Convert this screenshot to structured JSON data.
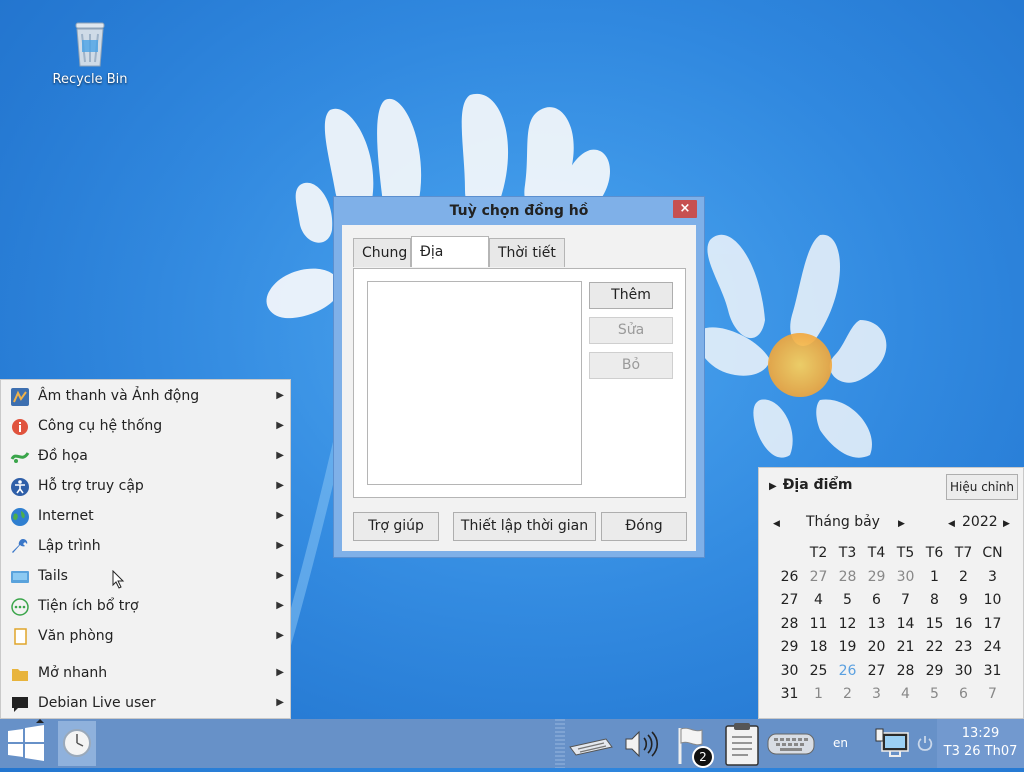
{
  "desktop": {
    "icons": [
      {
        "label": "Recycle Bin",
        "icon": "recycle-bin-icon"
      }
    ]
  },
  "dialog": {
    "title": "Tuỳ chọn đồng hồ",
    "close_symbol": "×",
    "tabs": [
      {
        "label": "Chung",
        "active": false
      },
      {
        "label": "Địa điểm",
        "active": true
      },
      {
        "label": "Thời tiết",
        "active": false
      }
    ],
    "side_buttons": [
      {
        "label": "Thêm",
        "enabled": true
      },
      {
        "label": "Sửa",
        "enabled": false
      },
      {
        "label": "Bỏ",
        "enabled": false
      }
    ],
    "bottom_buttons": {
      "help": "Trợ giúp",
      "set_time": "Thiết lập thời gian",
      "close": "Đóng"
    }
  },
  "start_menu": {
    "items": [
      {
        "label": "Âm thanh và Ảnh động",
        "icon": "multimedia-icon"
      },
      {
        "label": "Công cụ hệ thống",
        "icon": "system-info-icon"
      },
      {
        "label": "Đồ họa",
        "icon": "graphics-icon"
      },
      {
        "label": "Hỗ trợ truy cập",
        "icon": "accessibility-icon"
      },
      {
        "label": "Internet",
        "icon": "globe-icon"
      },
      {
        "label": "Lập trình",
        "icon": "wrench-icon"
      },
      {
        "label": "Tails",
        "icon": "tails-icon"
      },
      {
        "label": "Tiện ích bổ trợ",
        "icon": "accessories-icon"
      },
      {
        "label": "Văn phòng",
        "icon": "office-icon"
      },
      {
        "label": "Mở nhanh",
        "icon": "folder-icon"
      },
      {
        "label": "Debian Live user",
        "icon": "user-chat-icon"
      }
    ]
  },
  "calendar": {
    "locations_label": "Địa điểm",
    "edit_label": "Hiệu chỉnh",
    "month": "Tháng bảy",
    "year": "2022",
    "weekdays": [
      "T2",
      "T3",
      "T4",
      "T5",
      "T6",
      "T7",
      "CN"
    ],
    "weeks": [
      {
        "num": "26",
        "days": [
          "27",
          "28",
          "29",
          "30",
          "1",
          "2",
          "3"
        ]
      },
      {
        "num": "27",
        "days": [
          "4",
          "5",
          "6",
          "7",
          "8",
          "9",
          "10"
        ]
      },
      {
        "num": "28",
        "days": [
          "11",
          "12",
          "13",
          "14",
          "15",
          "16",
          "17"
        ]
      },
      {
        "num": "29",
        "days": [
          "18",
          "19",
          "20",
          "21",
          "22",
          "23",
          "24"
        ]
      },
      {
        "num": "30",
        "days": [
          "25",
          "26",
          "27",
          "28",
          "29",
          "30",
          "31"
        ]
      },
      {
        "num": "31",
        "days": [
          "1",
          "2",
          "3",
          "4",
          "5",
          "6",
          "7"
        ]
      }
    ],
    "today": "26"
  },
  "taskbar": {
    "notification_count": "2",
    "language": "en",
    "time": "13:29",
    "date": "T3 26 Th07"
  },
  "colors": {
    "taskbar": "#6791c8",
    "dialog_frame": "#7fb0e8",
    "close_button": "#c75050",
    "today_accent": "#5aa0e0"
  }
}
